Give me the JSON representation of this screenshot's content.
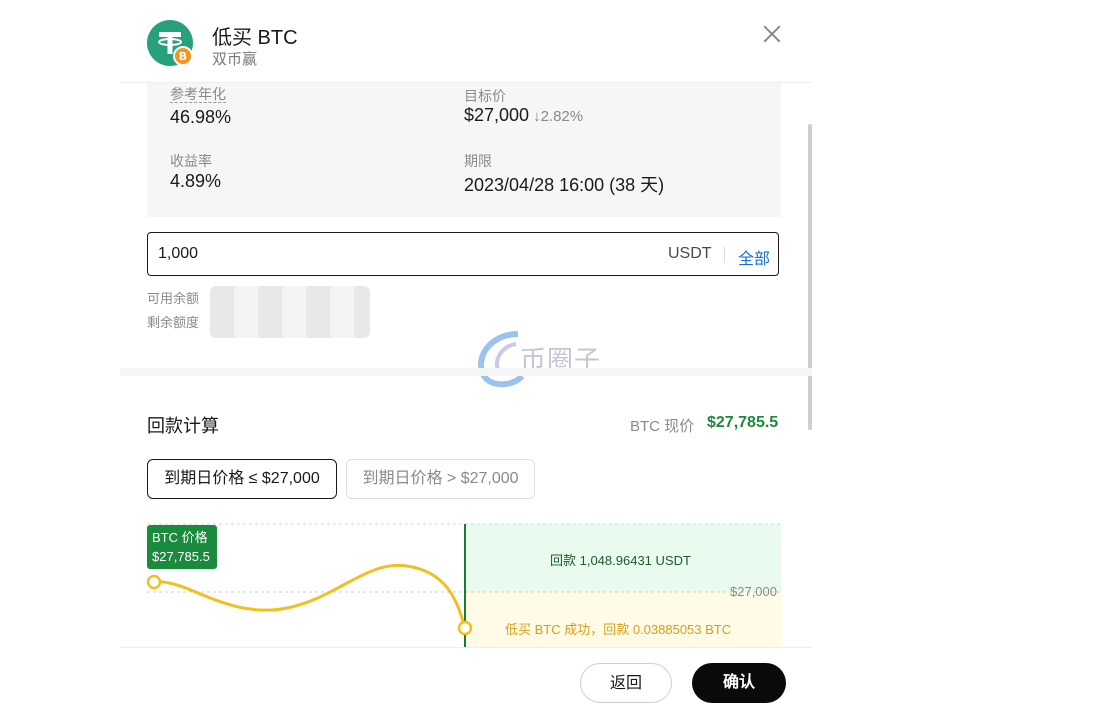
{
  "header": {
    "title": "低买 BTC",
    "subtitle": "双币赢"
  },
  "info": {
    "annual_label": "参考年化",
    "annual_value": "46.98%",
    "target_label": "目标价",
    "target_value": "$27,000",
    "target_change": "2.82%",
    "yield_label": "收益率",
    "yield_value": "4.89%",
    "term_label": "期限",
    "term_value": "2023/04/28 16:00 (38 天)"
  },
  "amount": {
    "value": "1,000",
    "unit": "USDT",
    "all_label": "全部"
  },
  "balance": {
    "available_label": "可用余额",
    "remaining_label": "剩余额度"
  },
  "watermark": {
    "text": "币圈子"
  },
  "calc": {
    "title": "回款计算",
    "btc_price_label": "BTC 现价",
    "btc_price_value": "$27,785.5",
    "tab_below": "到期日价格 ≤ $27,000",
    "tab_above": "到期日价格 > $27,000",
    "active_tab": "tab_below"
  },
  "chart_data": {
    "type": "line",
    "tag_title": "BTC 价格",
    "tag_value": "$27,785.5",
    "target_line_label": "$27,000",
    "refund_text": "回款 1,048.96431 USDT",
    "success_text": "低买 BTC 成功，回款 0.03885053 BTC",
    "colors": {
      "curve": "#f0c020",
      "green_zone": "#e9fbee",
      "yellow_zone": "#fffbe6",
      "marker": "#1a7a3a"
    }
  },
  "footer": {
    "back_label": "返回",
    "confirm_label": "确认"
  }
}
